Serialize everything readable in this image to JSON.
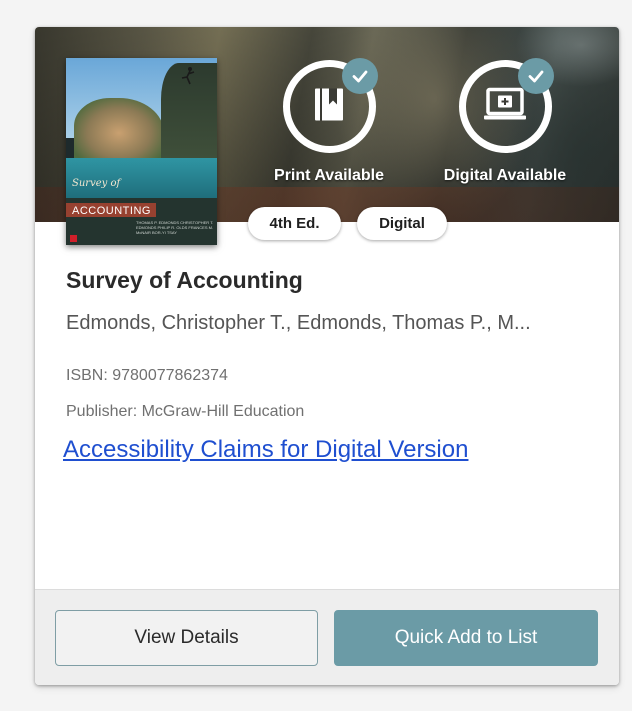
{
  "card": {
    "availability": {
      "print_label": "Print Available",
      "digital_label": "Digital Available",
      "print_icon": "book-icon",
      "digital_icon": "laptop-plus-icon",
      "check_icon": "check-icon",
      "accent_color": "#6b9ba6"
    },
    "cover": {
      "title_line1": "Survey of",
      "title_line2": "ACCOUNTING",
      "authors_text": "THOMAS P. EDMONDS CHRISTOPHER T. EDMONDS PHILIP R. OLDS FRANCES M. McNAIR BOR-YI TSAY"
    },
    "badges": {
      "edition": "4th Ed.",
      "format": "Digital"
    },
    "title": "Survey of Accounting",
    "authors": "Edmonds, Christopher T., Edmonds, Thomas P., M...",
    "isbn": "ISBN: 9780077862374",
    "publisher": "Publisher: McGraw-Hill Education",
    "accessibility_link": "Accessibility Claims for Digital Version",
    "buttons": {
      "view_details": "View Details",
      "quick_add": "Quick Add to List"
    }
  }
}
